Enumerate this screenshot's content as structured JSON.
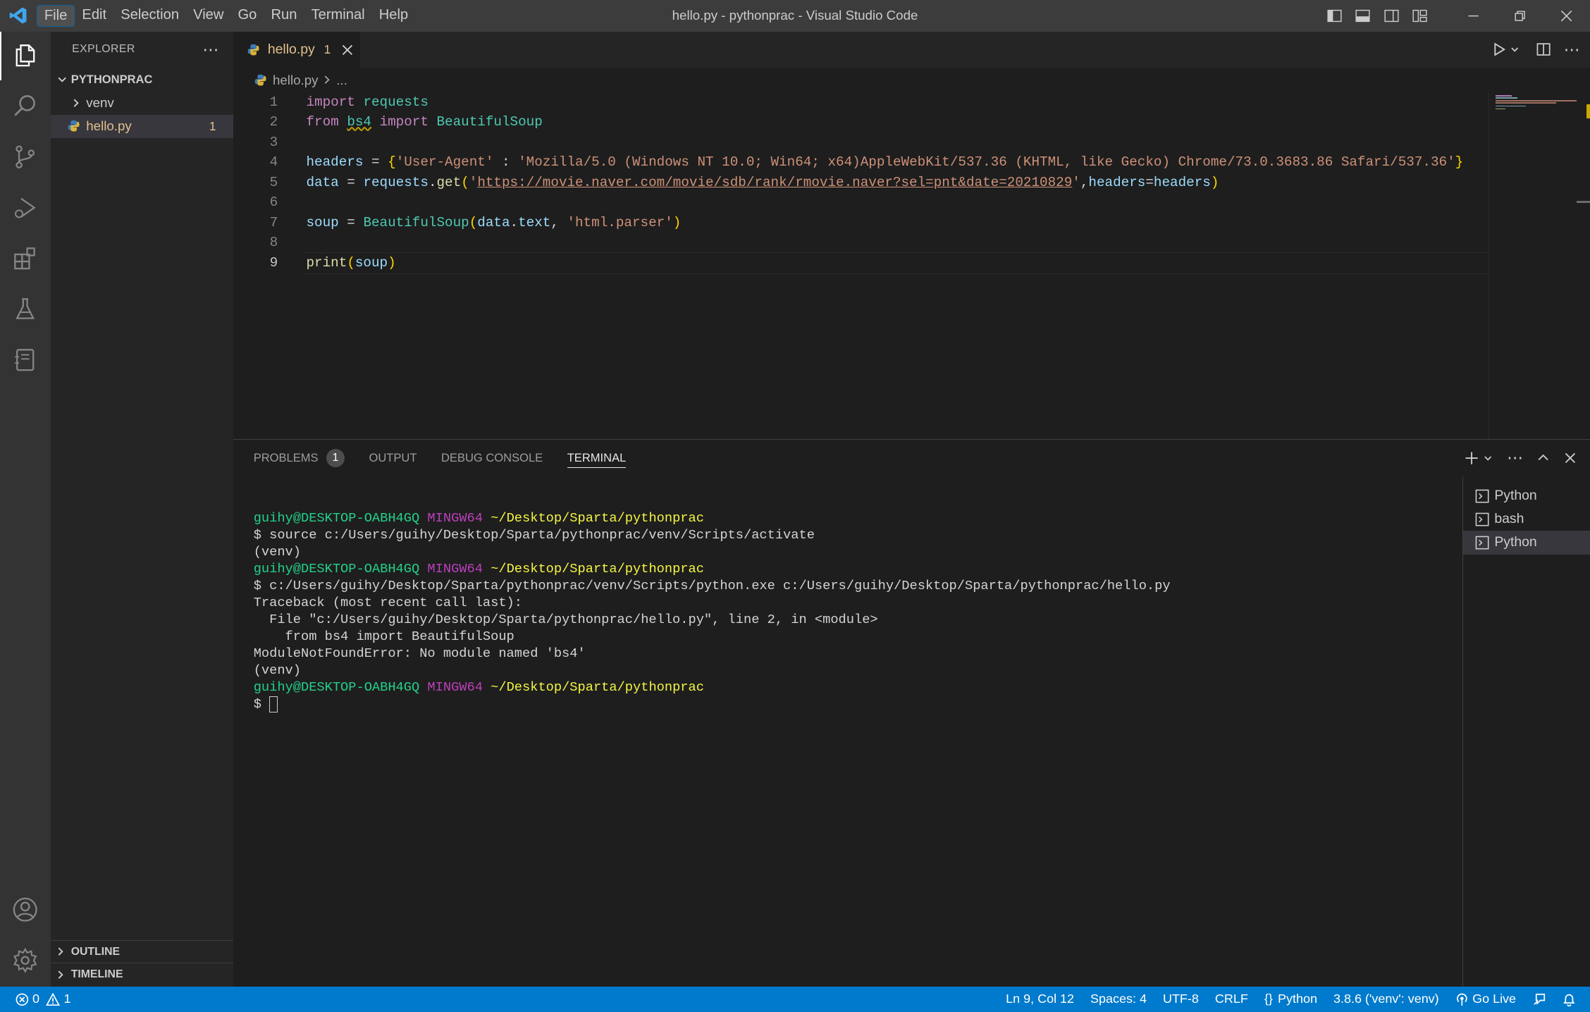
{
  "window": {
    "title": "hello.py - pythonprac - Visual Studio Code",
    "menu": [
      "File",
      "Edit",
      "Selection",
      "View",
      "Go",
      "Run",
      "Terminal",
      "Help"
    ],
    "active_menu": "File"
  },
  "sidebar": {
    "title": "EXPLORER",
    "folder": "PYTHONPRAC",
    "items": [
      {
        "label": "venv",
        "type": "folder"
      },
      {
        "label": "hello.py",
        "type": "file",
        "problems": "1"
      }
    ],
    "sections": [
      "OUTLINE",
      "TIMELINE"
    ]
  },
  "editor": {
    "tab": {
      "label": "hello.py",
      "problems": "1"
    },
    "breadcrumb": {
      "file": "hello.py",
      "rest": "..."
    },
    "lines": [
      {
        "num": "1",
        "t": [
          [
            "kw",
            "import"
          ],
          [
            "pl",
            " "
          ],
          [
            "mod",
            "requests"
          ]
        ]
      },
      {
        "num": "2",
        "t": [
          [
            "kw",
            "from"
          ],
          [
            "pl",
            " "
          ],
          [
            "mod squig",
            "bs4"
          ],
          [
            "pl",
            " "
          ],
          [
            "kw",
            "import"
          ],
          [
            "pl",
            " "
          ],
          [
            "mod",
            "BeautifulSoup"
          ]
        ]
      },
      {
        "num": "3",
        "t": []
      },
      {
        "num": "4",
        "t": [
          [
            "var",
            "headers"
          ],
          [
            "pl",
            " = "
          ],
          [
            "brk1",
            "{"
          ],
          [
            "str",
            "'User-Agent'"
          ],
          [
            "pl",
            " : "
          ],
          [
            "str",
            "'Mozilla/5.0 (Windows NT 10.0; Win64; x64)AppleWebKit/537.36 (KHTML, like Gecko) Chrome/73.0.3683.86 Safari/537.36'"
          ],
          [
            "brk1",
            "}"
          ]
        ]
      },
      {
        "num": "5",
        "t": [
          [
            "var",
            "data"
          ],
          [
            "pl",
            " = "
          ],
          [
            "var",
            "requests"
          ],
          [
            "pl",
            "."
          ],
          [
            "fn",
            "get"
          ],
          [
            "brk1",
            "("
          ],
          [
            "str",
            "'"
          ],
          [
            "str link",
            "https://movie.naver.com/movie/sdb/rank/rmovie.naver?sel=pnt&date=20210829"
          ],
          [
            "str",
            "'"
          ],
          [
            "pl",
            ","
          ],
          [
            "var",
            "headers"
          ],
          [
            "pl",
            "="
          ],
          [
            "var",
            "headers"
          ],
          [
            "brk1",
            ")"
          ]
        ]
      },
      {
        "num": "6",
        "t": []
      },
      {
        "num": "7",
        "t": [
          [
            "var",
            "soup"
          ],
          [
            "pl",
            " = "
          ],
          [
            "mod",
            "BeautifulSoup"
          ],
          [
            "brk1",
            "("
          ],
          [
            "var",
            "data"
          ],
          [
            "pl",
            "."
          ],
          [
            "var",
            "text"
          ],
          [
            "pl",
            ", "
          ],
          [
            "str",
            "'html.parser'"
          ],
          [
            "brk1",
            ")"
          ]
        ]
      },
      {
        "num": "8",
        "t": []
      },
      {
        "num": "9",
        "t": [
          [
            "fn",
            "print"
          ],
          [
            "brk1",
            "("
          ],
          [
            "var",
            "soup"
          ],
          [
            "brk1",
            ")"
          ]
        ]
      }
    ],
    "current_line": "9"
  },
  "panel": {
    "tabs": [
      "PROBLEMS",
      "OUTPUT",
      "DEBUG CONSOLE",
      "TERMINAL"
    ],
    "problems_count": "1",
    "active_tab": "TERMINAL",
    "terminal_lines": [
      [
        [
          "tg",
          "guihy@DESKTOP-OABH4GQ"
        ],
        [
          "pl",
          " "
        ],
        [
          "tm",
          "MINGW64"
        ],
        [
          "pl",
          " "
        ],
        [
          "ty",
          "~/Desktop/Sparta/pythonprac"
        ]
      ],
      [
        [
          "pl",
          "$ source c:/Users/guihy/Desktop/Sparta/pythonprac/venv/Scripts/activate"
        ]
      ],
      [
        [
          "pl",
          "(venv)"
        ]
      ],
      [
        [
          "tg",
          "guihy@DESKTOP-OABH4GQ"
        ],
        [
          "pl",
          " "
        ],
        [
          "tm",
          "MINGW64"
        ],
        [
          "pl",
          " "
        ],
        [
          "ty",
          "~/Desktop/Sparta/pythonprac"
        ]
      ],
      [
        [
          "pl",
          "$ c:/Users/guihy/Desktop/Sparta/pythonprac/venv/Scripts/python.exe c:/Users/guihy/Desktop/Sparta/pythonprac/hello.py"
        ]
      ],
      [
        [
          "pl",
          "Traceback (most recent call last):"
        ]
      ],
      [
        [
          "pl",
          "  File \"c:/Users/guihy/Desktop/Sparta/pythonprac/hello.py\", line 2, in <module>"
        ]
      ],
      [
        [
          "pl",
          "    from bs4 import BeautifulSoup"
        ]
      ],
      [
        [
          "pl",
          "ModuleNotFoundError: No module named 'bs4'"
        ]
      ],
      [
        [
          "pl",
          "(venv)"
        ]
      ],
      [
        [
          "tg",
          "guihy@DESKTOP-OABH4GQ"
        ],
        [
          "pl",
          " "
        ],
        [
          "tm",
          "MINGW64"
        ],
        [
          "pl",
          " "
        ],
        [
          "ty",
          "~/Desktop/Sparta/pythonprac"
        ]
      ],
      [
        [
          "pl",
          "$ "
        ]
      ]
    ],
    "terminals": [
      "Python",
      "bash",
      "Python"
    ],
    "selected_terminal": 2
  },
  "statusbar": {
    "errors": "0",
    "warnings": "1",
    "position": "Ln 9, Col 12",
    "spaces": "Spaces: 4",
    "encoding": "UTF-8",
    "eol": "CRLF",
    "language": "Python",
    "interpreter": "3.8.6 ('venv': venv)",
    "golive": "Go Live"
  },
  "colors": {
    "accent": "#007acc",
    "titlebar": "#3c3c3c",
    "activitybar": "#333333",
    "sidebar": "#252526",
    "editor": "#1e1e1e",
    "modified_file": "#e2c08d"
  }
}
